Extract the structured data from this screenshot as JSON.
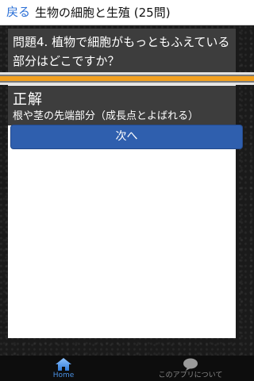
{
  "nav": {
    "back_label": "戻る",
    "title": "生物の細胞と生殖 (25問)"
  },
  "question": {
    "text": "問題4. 植物で細胞がもっともふえている部分はどこですか？"
  },
  "answer": {
    "heading": "正解",
    "text": "根や茎の先端部分（成長点とよばれる）"
  },
  "next_button": {
    "label": "次へ"
  },
  "tabs": [
    {
      "label": "Home",
      "icon": "home-icon",
      "active": true
    },
    {
      "label": "このアプリについて",
      "icon": "speech-bubble-icon",
      "active": false
    }
  ],
  "colors": {
    "link_blue": "#2a6fd6",
    "button_blue": "#2f5fae",
    "accent_orange": "#f2a01e",
    "tab_active": "#4a90e2"
  }
}
